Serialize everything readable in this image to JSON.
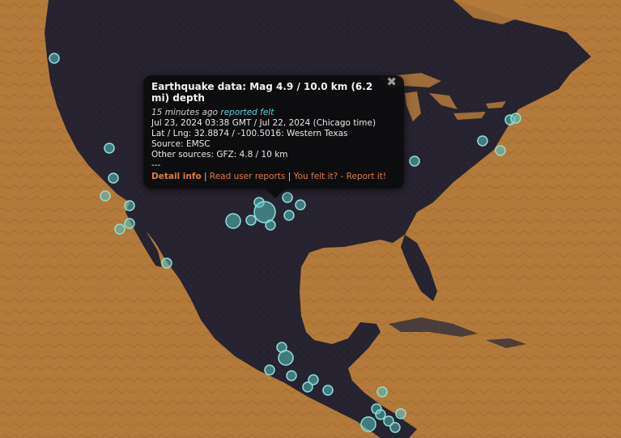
{
  "map": {
    "colors": {
      "land": "#26222f",
      "ocean": "#b47a3a",
      "marker_fill": "#58c3c0",
      "marker_stroke": "#8fe0da"
    },
    "markers": [
      {
        "name": "quake-marker-1",
        "size": "small"
      },
      {
        "name": "quake-marker-2",
        "size": "small"
      },
      {
        "name": "quake-marker-3",
        "size": "small"
      },
      {
        "name": "quake-marker-4",
        "size": "small"
      },
      {
        "name": "quake-marker-5",
        "size": "small"
      },
      {
        "name": "quake-marker-6",
        "size": "small"
      },
      {
        "name": "quake-marker-7",
        "size": "small"
      },
      {
        "name": "quake-marker-8",
        "size": "small"
      },
      {
        "name": "quake-marker-9",
        "size": "medium"
      },
      {
        "name": "quake-marker-10",
        "size": "small"
      },
      {
        "name": "quake-marker-11",
        "size": "small"
      },
      {
        "name": "quake-marker-12",
        "size": "large"
      },
      {
        "name": "quake-marker-13",
        "size": "small"
      },
      {
        "name": "quake-marker-14",
        "size": "small"
      },
      {
        "name": "quake-marker-15",
        "size": "small"
      },
      {
        "name": "quake-marker-16",
        "size": "small"
      },
      {
        "name": "quake-marker-17",
        "size": "small"
      },
      {
        "name": "quake-marker-18",
        "size": "small"
      },
      {
        "name": "quake-marker-19",
        "size": "small"
      },
      {
        "name": "quake-marker-20",
        "size": "small"
      },
      {
        "name": "quake-marker-21",
        "size": "small"
      },
      {
        "name": "quake-marker-22",
        "size": "small"
      },
      {
        "name": "quake-marker-23",
        "size": "medium"
      },
      {
        "name": "quake-marker-24",
        "size": "small"
      },
      {
        "name": "quake-marker-25",
        "size": "small"
      },
      {
        "name": "quake-marker-26",
        "size": "small"
      },
      {
        "name": "quake-marker-27",
        "size": "small"
      },
      {
        "name": "quake-marker-28",
        "size": "small"
      },
      {
        "name": "quake-marker-29",
        "size": "small"
      },
      {
        "name": "quake-marker-30",
        "size": "medium"
      }
    ]
  },
  "popup": {
    "close_glyph": "✖",
    "title": "Earthquake data: Mag 4.9 / 10.0 km (6.2 mi) depth",
    "ago": "15 minutes ago",
    "felt": "reported felt",
    "time": "Jul 23, 2024 03:38 GMT / Jul 22, 2024 (Chicago time)",
    "location": "Lat / Lng: 32.8874 / -100.5016: Western Texas",
    "source": "Source: EMSC",
    "other_sources": "Other sources: GFZ: 4.8 / 10 km",
    "divider": "---",
    "detail_info": "Detail info",
    "sep1": " | ",
    "read_reports": "Read user reports",
    "sep2": " | ",
    "you_felt": "You felt it? - Report it!"
  }
}
